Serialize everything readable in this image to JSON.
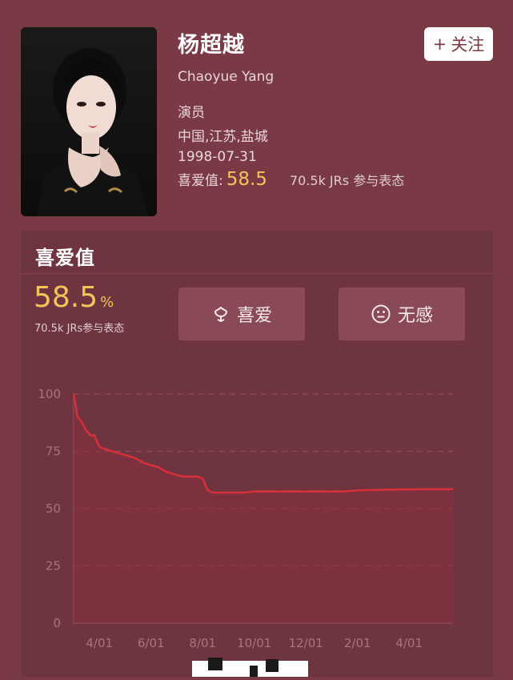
{
  "profile": {
    "name": "杨超越",
    "english_name": "Chaoyue Yang",
    "occupation": "演员",
    "location": "中国,江苏,盐城",
    "birthday": "1998-07-31",
    "rating_label": "喜爱值:",
    "rating_value": "58.5",
    "participants": "70.5k JRs 参与表态",
    "follow_plus": "+",
    "follow_label": "关注"
  },
  "panel": {
    "title": "喜爱值",
    "rating_value": "58.5",
    "rating_unit": "%",
    "participants": "70.5k JRs参与表态",
    "like_label": "喜爱",
    "meh_label": "无感"
  },
  "colors": {
    "background": "#7a3a45",
    "panel": "#6e3440",
    "accent_yellow": "#f6c25a",
    "line": "#d8303b"
  },
  "icons": {
    "like": "flower-icon",
    "meh": "neutral-face-icon"
  },
  "chart_data": {
    "type": "area",
    "title": "",
    "xlabel": "",
    "ylabel": "",
    "ylim": [
      0,
      100
    ],
    "yticks": [
      "0",
      "25",
      "50",
      "75",
      "100"
    ],
    "xticks": [
      "4/01",
      "6/01",
      "8/01",
      "10/01",
      "12/01",
      "2/01",
      "4/01"
    ],
    "xtick_months": [
      2,
      4,
      6,
      8,
      10,
      12,
      14
    ],
    "grid": "horizontal-dashed",
    "legend": "none",
    "series": [
      {
        "x": [
          1.0,
          1.05,
          1.15,
          1.3,
          1.5,
          1.65,
          1.8,
          2.0,
          2.2,
          2.5,
          2.8,
          3.1,
          3.4,
          3.7,
          4.0,
          4.3,
          4.6,
          4.9,
          5.2,
          5.5,
          5.8,
          6.0,
          6.2,
          6.4,
          6.8,
          7.2,
          7.6,
          8.0,
          9.0,
          10.0,
          11.0,
          11.5,
          12.0,
          13.0,
          14.0,
          15.0,
          15.7
        ],
        "values": [
          100,
          97,
          90,
          88,
          84,
          82,
          82,
          77,
          76,
          75,
          74,
          73,
          72,
          70,
          69,
          68,
          66,
          65,
          64,
          64,
          64,
          63,
          58,
          57,
          57,
          57,
          57,
          57.5,
          57.5,
          57.5,
          57.5,
          57.5,
          58,
          58.2,
          58.4,
          58.5,
          58.5
        ]
      }
    ]
  }
}
